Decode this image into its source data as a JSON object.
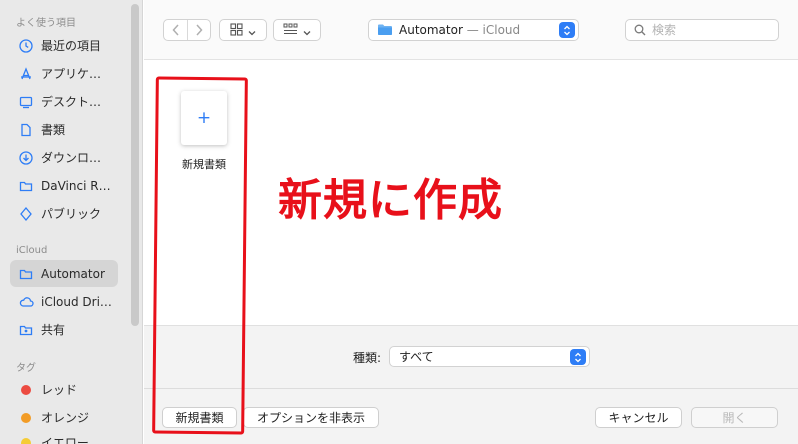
{
  "sidebar": {
    "favorites_header": "よく使う項目",
    "favorites": [
      {
        "label": "最近の項目",
        "icon": "clock-icon"
      },
      {
        "label": "アプリケ…",
        "icon": "apps-icon"
      },
      {
        "label": "デスクト…",
        "icon": "desktop-icon"
      },
      {
        "label": "書類",
        "icon": "document-icon"
      },
      {
        "label": "ダウンロ…",
        "icon": "download-icon"
      },
      {
        "label": "DaVinci R…",
        "icon": "folder-icon"
      },
      {
        "label": "パブリック",
        "icon": "public-icon"
      }
    ],
    "icloud_header": "iCloud",
    "icloud": [
      {
        "label": "Automator",
        "icon": "folder-icon",
        "selected": true
      },
      {
        "label": "iCloud Dri…",
        "icon": "cloud-icon"
      },
      {
        "label": "共有",
        "icon": "shared-folder-icon"
      }
    ],
    "tags_header": "タグ",
    "tags": [
      {
        "label": "レッド",
        "color": "#ec4b41"
      },
      {
        "label": "オレンジ",
        "color": "#f29c26"
      },
      {
        "label": "イエロー",
        "color": "#f5cc36"
      }
    ]
  },
  "toolbar": {
    "location_name": "Automator",
    "location_sub": " — iCloud",
    "search_placeholder": "検索"
  },
  "content": {
    "new_document_plus": "+",
    "new_document_label": "新規書類",
    "annotation_text": "新規に作成"
  },
  "bottom": {
    "kind_label": "種類:",
    "kind_value": "すべて",
    "new_document_button": "新規書類",
    "hide_options_button": "オプションを非表示",
    "cancel_button": "キャンセル",
    "open_button": "開く"
  },
  "colors": {
    "accent": "#2e7df6",
    "annotation_red": "#e8101a"
  }
}
